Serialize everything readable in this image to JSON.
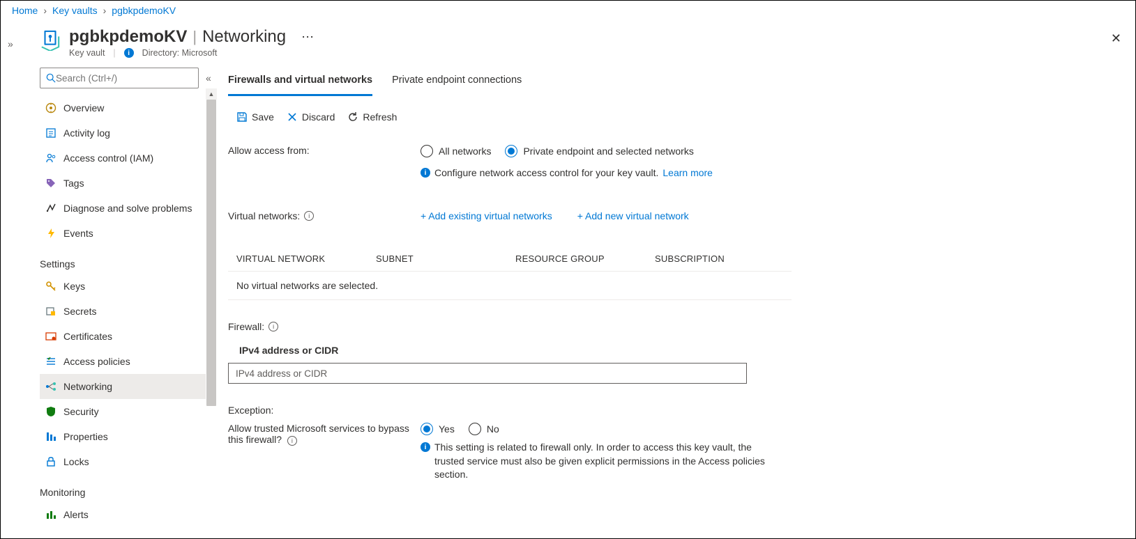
{
  "breadcrumb": {
    "home": "Home",
    "level1": "Key vaults",
    "level2": "pgbkpdemoKV"
  },
  "header": {
    "resource_name": "pgbkpdemoKV",
    "section": "Networking",
    "resource_type": "Key vault",
    "directory_label": "Directory: Microsoft"
  },
  "search": {
    "placeholder": "Search (Ctrl+/)"
  },
  "nav": {
    "top": [
      {
        "id": "overview",
        "label": "Overview"
      },
      {
        "id": "activity-log",
        "label": "Activity log"
      },
      {
        "id": "iam",
        "label": "Access control (IAM)"
      },
      {
        "id": "tags",
        "label": "Tags"
      },
      {
        "id": "diagnose",
        "label": "Diagnose and solve problems"
      },
      {
        "id": "events",
        "label": "Events"
      }
    ],
    "settings_title": "Settings",
    "settings": [
      {
        "id": "keys",
        "label": "Keys"
      },
      {
        "id": "secrets",
        "label": "Secrets"
      },
      {
        "id": "certificates",
        "label": "Certificates"
      },
      {
        "id": "access-policies",
        "label": "Access policies"
      },
      {
        "id": "networking",
        "label": "Networking",
        "active": true
      },
      {
        "id": "security",
        "label": "Security"
      },
      {
        "id": "properties",
        "label": "Properties"
      },
      {
        "id": "locks",
        "label": "Locks"
      }
    ],
    "monitoring_title": "Monitoring",
    "monitoring": [
      {
        "id": "alerts",
        "label": "Alerts"
      }
    ]
  },
  "tabs": {
    "firewalls": "Firewalls and virtual networks",
    "private_endpoints": "Private endpoint connections"
  },
  "toolbar": {
    "save": "Save",
    "discard": "Discard",
    "refresh": "Refresh"
  },
  "access": {
    "label": "Allow access from:",
    "all": "All networks",
    "selected": "Private endpoint and selected networks",
    "help_text": "Configure network access control for your key vault.",
    "learn_more": "Learn more"
  },
  "vnets": {
    "label": "Virtual networks:",
    "add_existing": "+ Add existing virtual networks",
    "add_new": "+ Add new virtual network",
    "cols": {
      "vnet": "VIRTUAL NETWORK",
      "subnet": "SUBNET",
      "rg": "RESOURCE GROUP",
      "sub": "SUBSCRIPTION"
    },
    "empty": "No virtual networks are selected."
  },
  "firewall": {
    "label": "Firewall:",
    "cidr_heading": "IPv4 address or CIDR",
    "cidr_placeholder": "IPv4 address or CIDR"
  },
  "exception": {
    "heading": "Exception:",
    "question": "Allow trusted Microsoft services to bypass this firewall?",
    "yes": "Yes",
    "no": "No",
    "help": "This setting is related to firewall only. In order to access this key vault, the trusted service must also be given explicit permissions in the Access policies section."
  }
}
